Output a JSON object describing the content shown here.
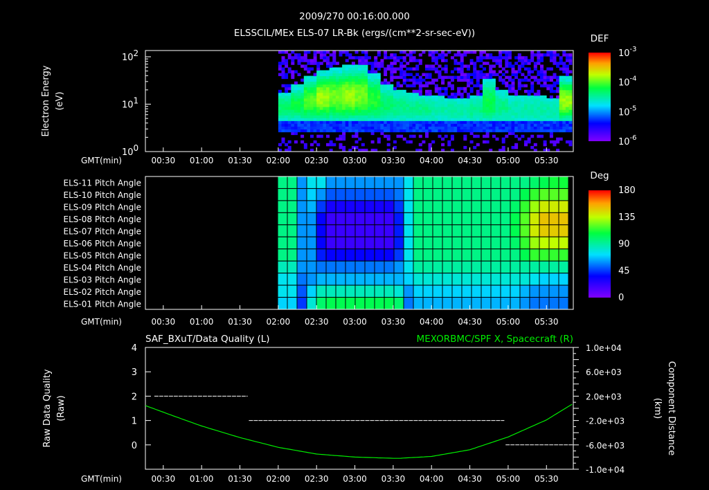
{
  "header": {
    "datetime": "2009/270 00:16:00.000",
    "title": "ELSSCIL/MEx ELS-07 LR-Bk  (ergs/(cm**2-sr-sec-eV))"
  },
  "time_axis": {
    "label": "GMT(min)",
    "ticks": [
      "00:30",
      "01:00",
      "01:30",
      "02:00",
      "02:30",
      "03:00",
      "03:30",
      "04:00",
      "04:30",
      "05:00",
      "05:30"
    ],
    "tick_minutes": [
      30,
      60,
      90,
      120,
      150,
      180,
      210,
      240,
      270,
      300,
      330
    ],
    "range_minutes": [
      16,
      351
    ]
  },
  "colors": {
    "green_trace": "#00ee00",
    "frame": "#ffffff",
    "background": "#000000"
  },
  "chart_data": [
    {
      "type": "heatmap",
      "name": "electron-spectrogram",
      "ylabel": "Electron Energy",
      "yunit": "(eV)",
      "yscale": "log",
      "ylim": [
        1,
        135
      ],
      "yticks": [
        {
          "base": "10",
          "exp": "0",
          "v": 1
        },
        {
          "base": "10",
          "exp": "1",
          "v": 10
        },
        {
          "base": "10",
          "exp": "2",
          "v": 100
        }
      ],
      "colorbar": {
        "title": "DEF",
        "ticks": [
          {
            "base": "10",
            "exp": "-3"
          },
          {
            "base": "10",
            "exp": "-4"
          },
          {
            "base": "10",
            "exp": "-5"
          },
          {
            "base": "10",
            "exp": "-6"
          }
        ]
      },
      "data_start_minute": 120,
      "column_minutes": 10,
      "band_upper_eV": [
        18,
        25,
        40,
        55,
        60,
        65,
        70,
        45,
        25,
        20,
        18,
        16,
        15,
        14,
        14,
        15,
        35,
        20,
        15,
        15,
        15,
        14,
        40
      ],
      "band_peak_log_def": [
        -4.4,
        -4.3,
        -4.1,
        -3.9,
        -4.0,
        -3.9,
        -4.0,
        -4.2,
        -4.4,
        -4.5,
        -4.5,
        -4.5,
        -4.6,
        -4.6,
        -4.6,
        -4.5,
        -4.3,
        -4.5,
        -4.6,
        -4.6,
        -4.6,
        -4.6,
        -3.9
      ],
      "band_lower_eV": 4.5
    },
    {
      "type": "heatmap",
      "name": "pitch-angle",
      "rows": [
        "ELS-11 Pitch Angle",
        "ELS-10 Pitch Angle",
        "ELS-09 Pitch Angle",
        "ELS-08 Pitch Angle",
        "ELS-07 Pitch Angle",
        "ELS-06 Pitch Angle",
        "ELS-05 Pitch Angle",
        "ELS-04 Pitch Angle",
        "ELS-03 Pitch Angle",
        "ELS-02 Pitch Angle",
        "ELS-01 Pitch Angle"
      ],
      "colorbar": {
        "title": "Deg",
        "ticks": [
          "180",
          "135",
          "90",
          "45",
          "0"
        ],
        "range": [
          0,
          180
        ]
      },
      "data_start_minute": 120,
      "column_minutes": 7.6,
      "values_deg": [
        [
          95,
          95,
          60,
          75,
          75,
          60,
          60,
          60,
          60,
          60,
          60,
          60,
          60,
          75,
          95,
          95,
          95,
          95,
          95,
          95,
          95,
          95,
          95,
          95,
          95,
          95,
          100,
          105,
          110,
          110
        ],
        [
          95,
          95,
          60,
          70,
          60,
          50,
          50,
          50,
          50,
          50,
          50,
          50,
          55,
          75,
          95,
          95,
          95,
          95,
          95,
          95,
          95,
          95,
          95,
          95,
          95,
          105,
          115,
          120,
          120,
          120
        ],
        [
          95,
          95,
          60,
          65,
          45,
          30,
          30,
          30,
          30,
          30,
          30,
          30,
          45,
          75,
          95,
          95,
          95,
          95,
          95,
          95,
          95,
          95,
          95,
          95,
          100,
          115,
          130,
          140,
          140,
          140
        ],
        [
          95,
          95,
          60,
          60,
          35,
          20,
          20,
          20,
          20,
          20,
          20,
          20,
          40,
          75,
          95,
          95,
          95,
          95,
          95,
          95,
          95,
          95,
          95,
          95,
          105,
          120,
          140,
          150,
          150,
          150
        ],
        [
          95,
          95,
          60,
          60,
          35,
          20,
          20,
          20,
          20,
          20,
          20,
          20,
          40,
          75,
          95,
          95,
          95,
          95,
          95,
          95,
          95,
          95,
          95,
          95,
          105,
          120,
          140,
          148,
          148,
          148
        ],
        [
          95,
          95,
          60,
          60,
          35,
          20,
          20,
          20,
          20,
          20,
          20,
          20,
          40,
          75,
          95,
          95,
          95,
          95,
          95,
          95,
          95,
          95,
          95,
          95,
          100,
          115,
          130,
          135,
          135,
          135
        ],
        [
          95,
          95,
          60,
          60,
          40,
          35,
          35,
          35,
          35,
          35,
          35,
          35,
          45,
          75,
          95,
          95,
          95,
          95,
          95,
          95,
          95,
          95,
          95,
          95,
          95,
          105,
          115,
          115,
          115,
          115
        ],
        [
          85,
          85,
          60,
          60,
          55,
          55,
          55,
          55,
          55,
          55,
          55,
          55,
          60,
          75,
          90,
          90,
          90,
          90,
          90,
          90,
          90,
          90,
          90,
          90,
          90,
          90,
          90,
          90,
          90,
          90
        ],
        [
          75,
          75,
          55,
          60,
          65,
          65,
          65,
          65,
          65,
          65,
          65,
          65,
          65,
          70,
          80,
          80,
          80,
          80,
          80,
          80,
          80,
          80,
          80,
          80,
          80,
          80,
          75,
          70,
          70,
          70
        ],
        [
          75,
          75,
          50,
          70,
          85,
          85,
          85,
          85,
          85,
          85,
          85,
          85,
          80,
          60,
          70,
          70,
          70,
          70,
          70,
          70,
          70,
          70,
          70,
          70,
          70,
          65,
          60,
          60,
          60,
          60
        ],
        [
          70,
          70,
          45,
          80,
          100,
          105,
          105,
          105,
          105,
          105,
          105,
          105,
          100,
          55,
          65,
          65,
          65,
          65,
          65,
          65,
          65,
          65,
          65,
          65,
          65,
          60,
          55,
          55,
          55,
          55
        ]
      ]
    },
    {
      "type": "line",
      "name": "data-quality-and-position",
      "title_left": "SAF_BXuT/Data Quality (L)",
      "title_right": "MEXORBMC/SPF X, Spacecraft (R)",
      "ylabel_left": "Raw Data Quality",
      "ylabel_left_unit": "(Raw)",
      "ylabel_right": "Component Distance",
      "ylabel_right_unit": "(km)",
      "ylim_left": [
        -1,
        4
      ],
      "yticks_left": [
        "4",
        "3",
        "2",
        "1",
        "0"
      ],
      "ylim_right": [
        -10000,
        10000
      ],
      "yticks_right": [
        {
          "v": 10000,
          "label": "1.0e+04"
        },
        {
          "v": 6000,
          "label": "6.0e+03"
        },
        {
          "v": 2000,
          "label": "2.0e+03"
        },
        {
          "v": -2000,
          "label": "-2.0e+03"
        },
        {
          "v": -6000,
          "label": "-6.0e+03"
        },
        {
          "v": -10000,
          "label": "-1.0e+04"
        }
      ],
      "quality_segments": [
        {
          "start_min": 23,
          "end_min": 96,
          "value": 2
        },
        {
          "start_min": 97,
          "end_min": 297,
          "value": 1
        },
        {
          "start_min": 298,
          "end_min": 351,
          "value": 0
        }
      ],
      "position_series": {
        "x_min": [
          16,
          40,
          60,
          90,
          120,
          150,
          180,
          210,
          215,
          240,
          270,
          300,
          330,
          351
        ],
        "y_km": [
          450,
          -1400,
          -2900,
          -4800,
          -6400,
          -7500,
          -8000,
          -8200,
          -8200,
          -7900,
          -6800,
          -4700,
          -1900,
          800
        ]
      }
    }
  ]
}
